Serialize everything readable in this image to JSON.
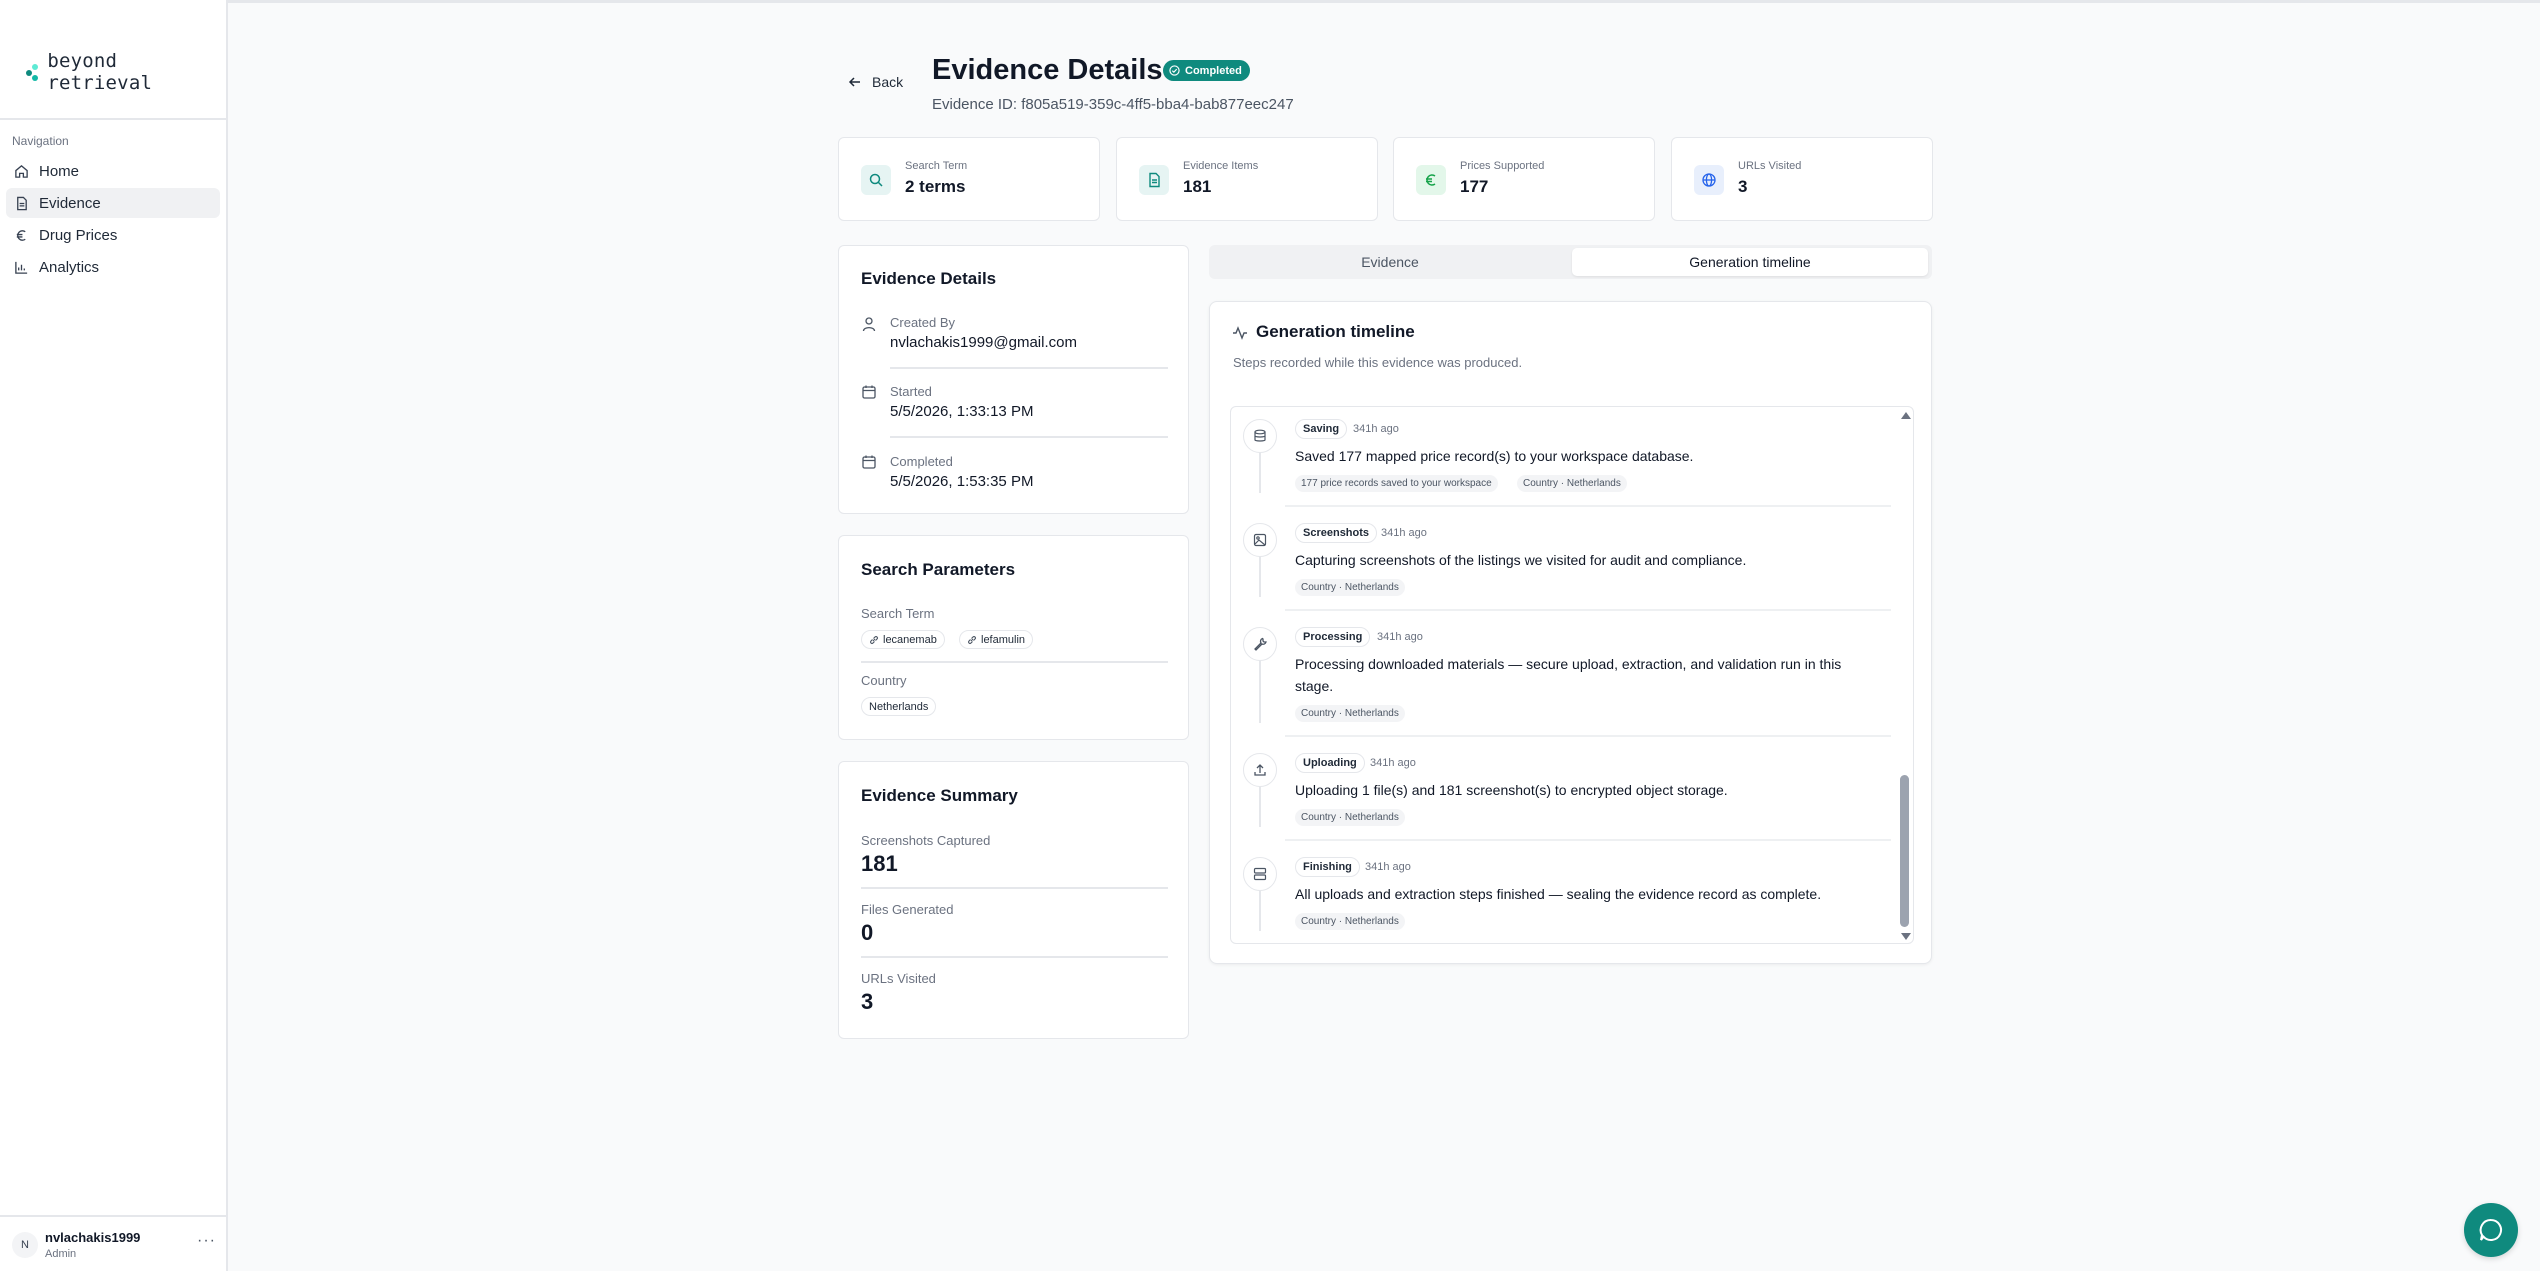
{
  "app": {
    "logo_text": "beyond retrieval"
  },
  "sidebar": {
    "section_title": "Navigation",
    "items": [
      {
        "label": "Home",
        "icon": "home-icon"
      },
      {
        "label": "Evidence",
        "icon": "file-text-icon",
        "active": true
      },
      {
        "label": "Drug Prices",
        "icon": "euro-icon"
      },
      {
        "label": "Analytics",
        "icon": "bar-chart-icon"
      }
    ],
    "user": {
      "initial": "N",
      "name": "nvlachakis1999",
      "role": "Admin",
      "more": "···"
    }
  },
  "header": {
    "back_label": "Back",
    "title": "Evidence Details",
    "status": "Completed",
    "evidence_id": "Evidence ID: f805a519-359c-4ff5-bba4-bab877eec247"
  },
  "stats": [
    {
      "label": "Search Term",
      "value": "2 terms",
      "icon": "search-icon"
    },
    {
      "label": "Evidence Items",
      "value": "181",
      "icon": "file-icon"
    },
    {
      "label": "Prices Supported",
      "value": "177",
      "icon": "euro-icon"
    },
    {
      "label": "URLs Visited",
      "value": "3",
      "icon": "globe-icon"
    }
  ],
  "details": {
    "title": "Evidence Details",
    "created_by_label": "Created By",
    "created_by": "nvlachakis1999@gmail.com",
    "started_label": "Started",
    "started": "5/5/2026, 1:33:13 PM",
    "completed_label": "Completed",
    "completed": "5/5/2026, 1:53:35 PM"
  },
  "params": {
    "title": "Search Parameters",
    "search_term_label": "Search Term",
    "terms": [
      "lecanemab",
      "lefamulin"
    ],
    "country_label": "Country",
    "country": "Netherlands"
  },
  "summary": {
    "title": "Evidence Summary",
    "screenshots_label": "Screenshots Captured",
    "screenshots": "181",
    "files_label": "Files Generated",
    "files": "0",
    "urls_label": "URLs Visited",
    "urls": "3"
  },
  "tabs": {
    "evidence": "Evidence",
    "timeline": "Generation timeline",
    "active": "timeline"
  },
  "timeline": {
    "title": "Generation timeline",
    "subtitle": "Steps recorded while this evidence was produced.",
    "steps": [
      {
        "stage": "Saving",
        "ago": "341h ago",
        "text": "Saved 177 mapped price record(s) to your workspace database.",
        "chips": [
          "177 price records saved to your workspace",
          "Country · Netherlands"
        ],
        "icon": "database-icon"
      },
      {
        "stage": "Screenshots",
        "ago": "341h ago",
        "text": "Capturing screenshots of the listings we visited for audit and compliance.",
        "chips": [
          "Country · Netherlands"
        ],
        "icon": "image-icon"
      },
      {
        "stage": "Processing",
        "ago": "341h ago",
        "text": "Processing downloaded materials — secure upload, extraction, and validation run in this stage.",
        "chips": [
          "Country · Netherlands"
        ],
        "icon": "wrench-icon"
      },
      {
        "stage": "Uploading",
        "ago": "341h ago",
        "text": "Uploading 1 file(s) and 181 screenshot(s) to encrypted object storage.",
        "chips": [
          "Country · Netherlands"
        ],
        "icon": "upload-icon"
      },
      {
        "stage": "Finishing",
        "ago": "341h ago",
        "text": "All uploads and extraction steps finished — sealing the evidence record as complete.",
        "chips": [
          "Country · Netherlands"
        ],
        "icon": "server-icon"
      }
    ]
  },
  "colors": {
    "accent": "#0f8a7e",
    "border": "#e5e7eb"
  }
}
